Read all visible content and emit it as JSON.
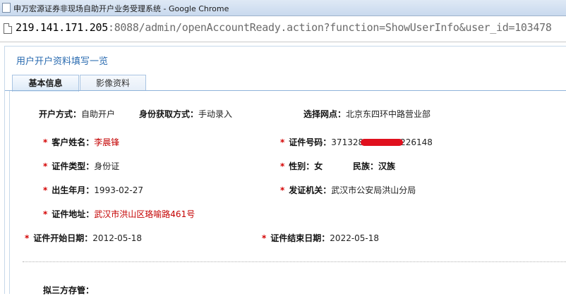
{
  "window": {
    "title": "申万宏源证券非现场自助开户业务受理系统 - Google Chrome"
  },
  "address": {
    "host": "219.141.171.205",
    "rest": ":8088/admin/openAccountReady.action?function=ShowUserInfo&user_id=103478"
  },
  "page": {
    "title": "用户开户资料填写一览"
  },
  "tabs": [
    {
      "label": "基本信息"
    },
    {
      "label": "影像资料"
    }
  ],
  "info": {
    "open_method": {
      "label": "开户方式：",
      "value": "自助开户"
    },
    "id_method": {
      "label": "身份获取方式：",
      "value": "手动录入"
    },
    "branch": {
      "label": "选择网点：",
      "value": "北京东四环中路营业部"
    },
    "name": {
      "label": "客户姓名：",
      "value": "李晨锋"
    },
    "id_number": {
      "label": "证件号码：",
      "value_prefix": "371328",
      "value_suffix": "226148"
    },
    "id_type": {
      "label": "证件类型：",
      "value": "身份证"
    },
    "gender": {
      "label": "性别：",
      "value": "女"
    },
    "ethnicity": {
      "label": "民族：",
      "value": "汉族"
    },
    "birth": {
      "label": "出生年月：",
      "value": "1993-02-27"
    },
    "issuer": {
      "label": "发证机关：",
      "value": "武汉市公安局洪山分局"
    },
    "address": {
      "label": "证件地址：",
      "value": "武汉市洪山区珞喻路461号"
    },
    "start_date": {
      "label": "证件开始日期：",
      "value": "2012-05-18"
    },
    "end_date": {
      "label": "证件结束日期：",
      "value": "2022-05-18"
    },
    "depository": {
      "label": "拟三方存管："
    }
  },
  "required_mark": "*",
  "colors": {
    "title_blue": "#2a6bb0",
    "required_red": "#d40000",
    "value_red": "#c40000"
  }
}
